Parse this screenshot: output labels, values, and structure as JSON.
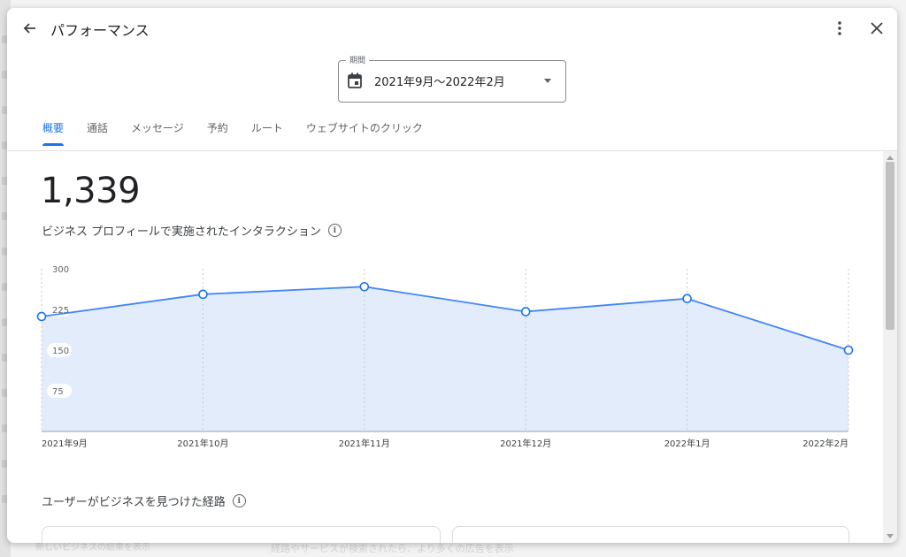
{
  "dialog": {
    "title": "パフォーマンス",
    "period_label": "期間",
    "period_value": "2021年9月～2022年2月"
  },
  "tabs": [
    {
      "label": "概要",
      "active": true
    },
    {
      "label": "通話",
      "active": false
    },
    {
      "label": "メッセージ",
      "active": false
    },
    {
      "label": "予約",
      "active": false
    },
    {
      "label": "ルート",
      "active": false
    },
    {
      "label": "ウェブサイトのクリック",
      "active": false
    }
  ],
  "summary": {
    "total": "1,339",
    "description": "ビジネス プロフィールで実施されたインタラクション"
  },
  "section": {
    "title": "ユーザーがビジネスを見つけた経路"
  },
  "colors": {
    "accent": "#1a73e8",
    "line": "#4285f4",
    "area": "#e3ecfa"
  },
  "chart_data": {
    "type": "area",
    "categories": [
      "2021年9月",
      "2021年10月",
      "2021年11月",
      "2021年12月",
      "2022年1月",
      "2022年2月"
    ],
    "series": [
      {
        "values": [
          212,
          253,
          267,
          221,
          245,
          150
        ]
      }
    ],
    "yticks": [
      75,
      150,
      225,
      300
    ],
    "ylim": [
      0,
      300
    ],
    "grid": "vertical-dashed"
  },
  "background": {
    "bottom_text": "経路やサービスが検索されたら、より多くの広告を表示",
    "bottom_left": "新しいビジネスの結果を表示"
  }
}
